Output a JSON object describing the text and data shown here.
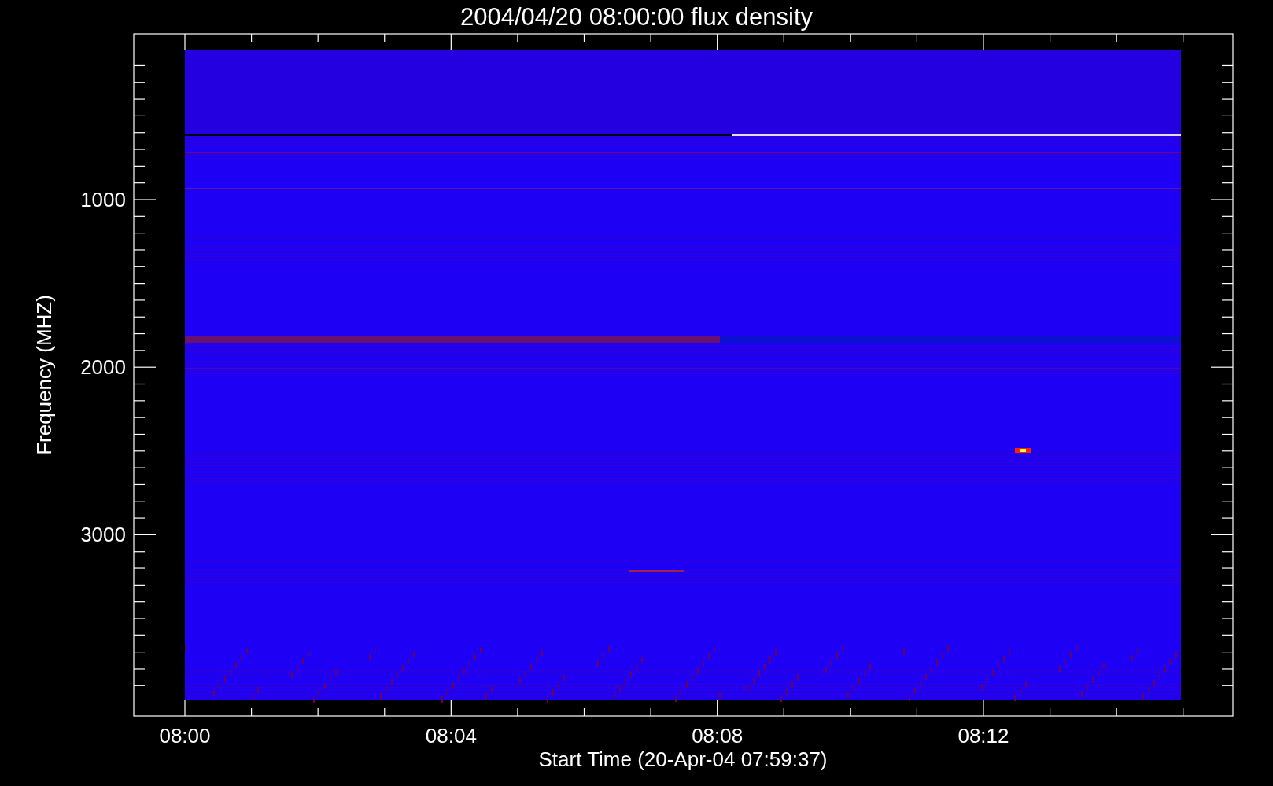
{
  "plot": {
    "title": "2004/04/20 08:00:00 flux density",
    "ylabel": "Frequency (MHZ)",
    "xlabel": "Start Time (20-Apr-04 07:59:37)",
    "x_tick_labels": [
      "08:00",
      "08:04",
      "08:08",
      "08:12"
    ],
    "y_tick_labels": [
      "1000",
      "2000",
      "3000"
    ]
  }
}
